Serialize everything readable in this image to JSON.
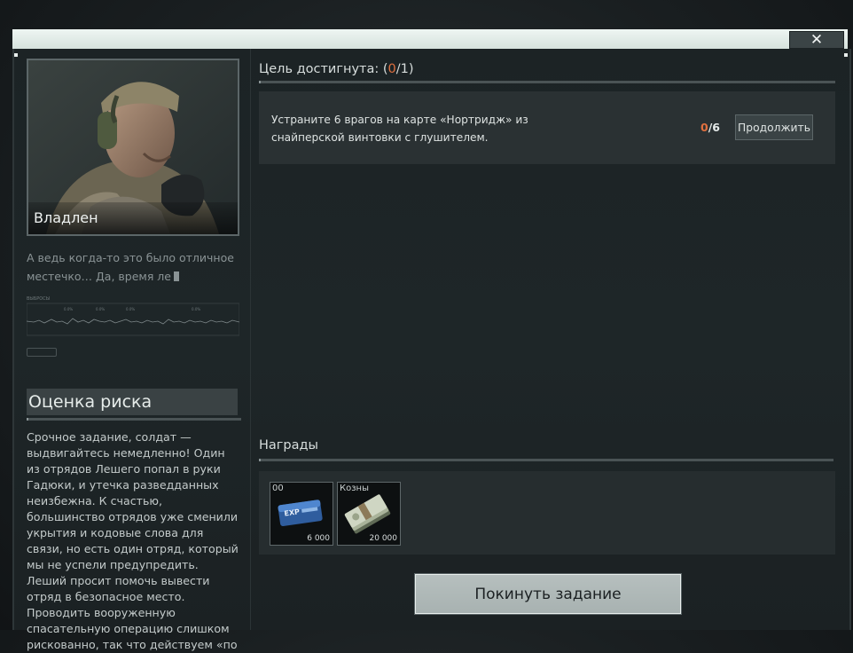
{
  "window": {
    "close_icon": "close-x-icon"
  },
  "trader": {
    "name": "Владлен",
    "quote": "А ведь когда-то это было отличное местечко… Да, время ле",
    "wave_labels": [
      "ВЫБРОСЫ",
      "0.0%",
      "0.0%",
      "0.0%",
      "0.0%"
    ]
  },
  "risk": {
    "title": "Оценка риска",
    "text": "Срочное задание, солдат — выдвигайтесь немедленно! Один из отрядов Лешего попал в руки Гадюки, и утечка разведданных неизбежна. К счастью, большинство отрядов уже сменили укрытия и кодовые слова для связи, но есть один отряд, который мы не успели предупредить. Леший просит помочь вывести отряд в безопасное место. Проводить вооруженную спасательную операцию слишком рискованно, так что действуем «по"
  },
  "objectives": {
    "title_prefix": "Цель достигнута: (",
    "done": "0",
    "sep": "/",
    "total": "1",
    "title_suffix": ")",
    "items": [
      {
        "text": "Устраните 6 врагов на карте «Нортридж» из снайперской винтовки с глушителем.",
        "current": "0",
        "target": "/6",
        "button": "Продолжить"
      }
    ]
  },
  "rewards": {
    "title": "Награды",
    "items": [
      {
        "label": "00",
        "amount": "6 000",
        "icon": "exp-token-icon"
      },
      {
        "label": "Козны",
        "amount": "20 000",
        "icon": "cash-bundle-icon"
      }
    ]
  },
  "actions": {
    "leave": "Покинуть задание"
  },
  "colors": {
    "accent_orange": "#e0703f",
    "panel": "#1e2628",
    "header_bar": "#e4eeea"
  }
}
